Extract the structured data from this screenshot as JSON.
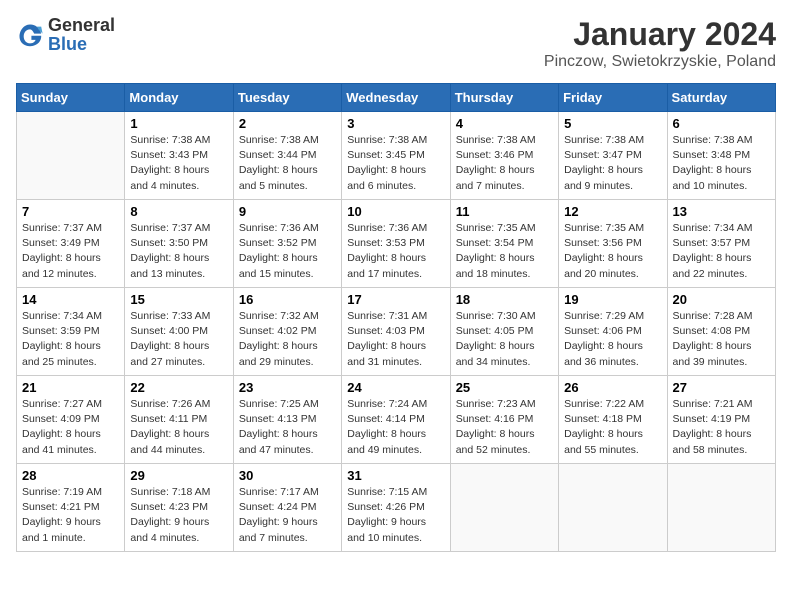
{
  "header": {
    "logo_general": "General",
    "logo_blue": "Blue",
    "title": "January 2024",
    "subtitle": "Pinczow, Swietokrzyskie, Poland"
  },
  "days_of_week": [
    "Sunday",
    "Monday",
    "Tuesday",
    "Wednesday",
    "Thursday",
    "Friday",
    "Saturday"
  ],
  "weeks": [
    [
      {
        "day": "",
        "info": ""
      },
      {
        "day": "1",
        "info": "Sunrise: 7:38 AM\nSunset: 3:43 PM\nDaylight: 8 hours\nand 4 minutes."
      },
      {
        "day": "2",
        "info": "Sunrise: 7:38 AM\nSunset: 3:44 PM\nDaylight: 8 hours\nand 5 minutes."
      },
      {
        "day": "3",
        "info": "Sunrise: 7:38 AM\nSunset: 3:45 PM\nDaylight: 8 hours\nand 6 minutes."
      },
      {
        "day": "4",
        "info": "Sunrise: 7:38 AM\nSunset: 3:46 PM\nDaylight: 8 hours\nand 7 minutes."
      },
      {
        "day": "5",
        "info": "Sunrise: 7:38 AM\nSunset: 3:47 PM\nDaylight: 8 hours\nand 9 minutes."
      },
      {
        "day": "6",
        "info": "Sunrise: 7:38 AM\nSunset: 3:48 PM\nDaylight: 8 hours\nand 10 minutes."
      }
    ],
    [
      {
        "day": "7",
        "info": "Sunrise: 7:37 AM\nSunset: 3:49 PM\nDaylight: 8 hours\nand 12 minutes."
      },
      {
        "day": "8",
        "info": "Sunrise: 7:37 AM\nSunset: 3:50 PM\nDaylight: 8 hours\nand 13 minutes."
      },
      {
        "day": "9",
        "info": "Sunrise: 7:36 AM\nSunset: 3:52 PM\nDaylight: 8 hours\nand 15 minutes."
      },
      {
        "day": "10",
        "info": "Sunrise: 7:36 AM\nSunset: 3:53 PM\nDaylight: 8 hours\nand 17 minutes."
      },
      {
        "day": "11",
        "info": "Sunrise: 7:35 AM\nSunset: 3:54 PM\nDaylight: 8 hours\nand 18 minutes."
      },
      {
        "day": "12",
        "info": "Sunrise: 7:35 AM\nSunset: 3:56 PM\nDaylight: 8 hours\nand 20 minutes."
      },
      {
        "day": "13",
        "info": "Sunrise: 7:34 AM\nSunset: 3:57 PM\nDaylight: 8 hours\nand 22 minutes."
      }
    ],
    [
      {
        "day": "14",
        "info": "Sunrise: 7:34 AM\nSunset: 3:59 PM\nDaylight: 8 hours\nand 25 minutes."
      },
      {
        "day": "15",
        "info": "Sunrise: 7:33 AM\nSunset: 4:00 PM\nDaylight: 8 hours\nand 27 minutes."
      },
      {
        "day": "16",
        "info": "Sunrise: 7:32 AM\nSunset: 4:02 PM\nDaylight: 8 hours\nand 29 minutes."
      },
      {
        "day": "17",
        "info": "Sunrise: 7:31 AM\nSunset: 4:03 PM\nDaylight: 8 hours\nand 31 minutes."
      },
      {
        "day": "18",
        "info": "Sunrise: 7:30 AM\nSunset: 4:05 PM\nDaylight: 8 hours\nand 34 minutes."
      },
      {
        "day": "19",
        "info": "Sunrise: 7:29 AM\nSunset: 4:06 PM\nDaylight: 8 hours\nand 36 minutes."
      },
      {
        "day": "20",
        "info": "Sunrise: 7:28 AM\nSunset: 4:08 PM\nDaylight: 8 hours\nand 39 minutes."
      }
    ],
    [
      {
        "day": "21",
        "info": "Sunrise: 7:27 AM\nSunset: 4:09 PM\nDaylight: 8 hours\nand 41 minutes."
      },
      {
        "day": "22",
        "info": "Sunrise: 7:26 AM\nSunset: 4:11 PM\nDaylight: 8 hours\nand 44 minutes."
      },
      {
        "day": "23",
        "info": "Sunrise: 7:25 AM\nSunset: 4:13 PM\nDaylight: 8 hours\nand 47 minutes."
      },
      {
        "day": "24",
        "info": "Sunrise: 7:24 AM\nSunset: 4:14 PM\nDaylight: 8 hours\nand 49 minutes."
      },
      {
        "day": "25",
        "info": "Sunrise: 7:23 AM\nSunset: 4:16 PM\nDaylight: 8 hours\nand 52 minutes."
      },
      {
        "day": "26",
        "info": "Sunrise: 7:22 AM\nSunset: 4:18 PM\nDaylight: 8 hours\nand 55 minutes."
      },
      {
        "day": "27",
        "info": "Sunrise: 7:21 AM\nSunset: 4:19 PM\nDaylight: 8 hours\nand 58 minutes."
      }
    ],
    [
      {
        "day": "28",
        "info": "Sunrise: 7:19 AM\nSunset: 4:21 PM\nDaylight: 9 hours\nand 1 minute."
      },
      {
        "day": "29",
        "info": "Sunrise: 7:18 AM\nSunset: 4:23 PM\nDaylight: 9 hours\nand 4 minutes."
      },
      {
        "day": "30",
        "info": "Sunrise: 7:17 AM\nSunset: 4:24 PM\nDaylight: 9 hours\nand 7 minutes."
      },
      {
        "day": "31",
        "info": "Sunrise: 7:15 AM\nSunset: 4:26 PM\nDaylight: 9 hours\nand 10 minutes."
      },
      {
        "day": "",
        "info": ""
      },
      {
        "day": "",
        "info": ""
      },
      {
        "day": "",
        "info": ""
      }
    ]
  ]
}
